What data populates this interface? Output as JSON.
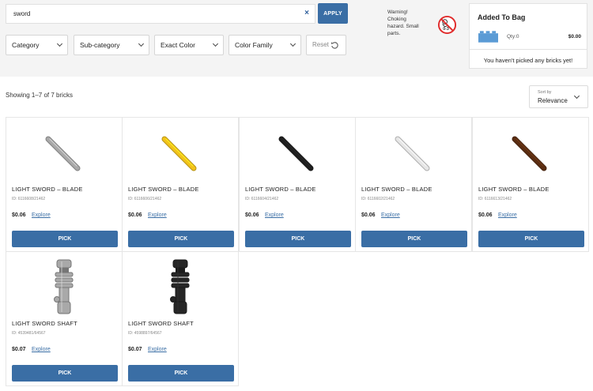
{
  "search": {
    "value": "sword",
    "clear_glyph": "×",
    "apply_label": "APPLY"
  },
  "filters": {
    "category": "Category",
    "subcategory": "Sub-category",
    "exact_color": "Exact Color",
    "color_family": "Color Family",
    "reset_label": "Reset"
  },
  "warning": {
    "lines": [
      "Warning!",
      "Choking",
      "hazard. Small",
      "parts."
    ],
    "icon_text": "0-3"
  },
  "bag": {
    "title": "Added To Bag",
    "qty": "Qty:0",
    "price": "$0.00",
    "empty_message": "You haven't picked any bricks yet!",
    "brick_color": "#5b9bd5"
  },
  "results": {
    "showing": "Showing 1–7 of 7 bricks"
  },
  "sort": {
    "label": "Sort by",
    "value": "Relevance"
  },
  "accent_color": "#3a6ea5",
  "products": [
    {
      "name": "LIGHT SWORD – BLADE",
      "id": "ID: 6116608/21462",
      "price": "$0.06",
      "explore": "Explore",
      "pick": "PICK",
      "kind": "blade",
      "color": "#a9a9a9"
    },
    {
      "name": "LIGHT SWORD – BLADE",
      "id": "ID: 6116606/21462",
      "price": "$0.06",
      "explore": "Explore",
      "pick": "PICK",
      "kind": "blade",
      "color": "#f2c21b"
    },
    {
      "name": "LIGHT SWORD – BLADE",
      "id": "ID: 6116604/21462",
      "price": "$0.06",
      "explore": "Explore",
      "pick": "PICK",
      "kind": "blade",
      "color": "#1f1f1f"
    },
    {
      "name": "LIGHT SWORD – BLADE",
      "id": "ID: 6116602/21462",
      "price": "$0.06",
      "explore": "Explore",
      "pick": "PICK",
      "kind": "blade",
      "color": "#e6e6e6"
    },
    {
      "name": "LIGHT SWORD – BLADE",
      "id": "ID: 6116613/21462",
      "price": "$0.06",
      "explore": "Explore",
      "pick": "PICK",
      "kind": "blade",
      "color": "#5a2d12"
    },
    {
      "name": "LIGHT SWORD SHAFT",
      "id": "ID: 4539481/64567",
      "price": "$0.07",
      "explore": "Explore",
      "pick": "PICK",
      "kind": "shaft",
      "color": "#a9a9a9"
    },
    {
      "name": "LIGHT SWORD SHAFT",
      "id": "ID: 4598897/64567",
      "price": "$0.07",
      "explore": "Explore",
      "pick": "PICK",
      "kind": "shaft",
      "color": "#262626"
    }
  ]
}
